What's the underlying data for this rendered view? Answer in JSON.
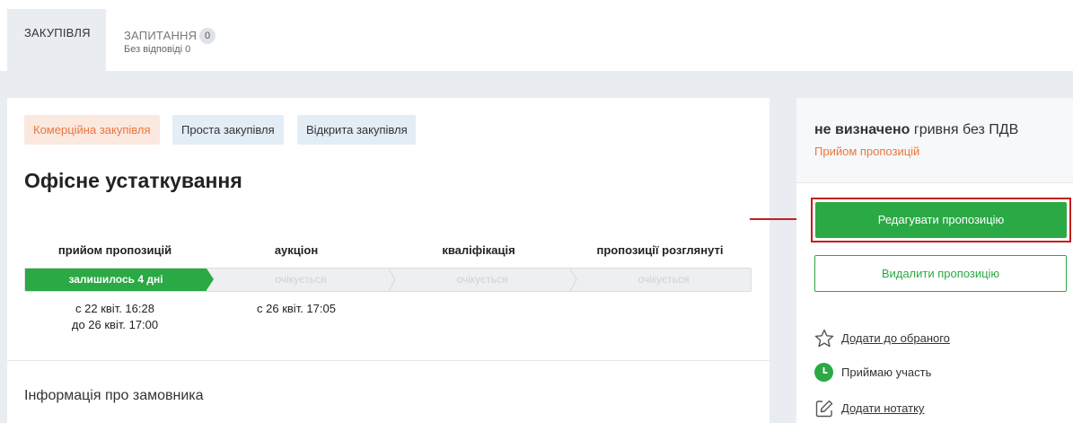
{
  "tabs": [
    {
      "label": "ЗАКУПІВЛЯ",
      "active": true
    },
    {
      "label": "ЗАПИТАННЯ",
      "count": "0",
      "sub": "Без відповіді 0"
    }
  ],
  "chips": [
    "Комерційна закупівля",
    "Проста закупівля",
    "Відкрита закупівля"
  ],
  "tender": {
    "title": "Офісне устаткування"
  },
  "stages": [
    {
      "title": "прийом пропозицій",
      "bar": "залишилось 4 дні",
      "dates": [
        "с 22 квіт. 16:28",
        "до 26 квіт. 17:00"
      ]
    },
    {
      "title": "аукціон",
      "bar": "очікується",
      "dates": [
        "с 26 квіт. 17:05"
      ]
    },
    {
      "title": "кваліфікація",
      "bar": "очікується",
      "dates": []
    },
    {
      "title": "пропозиції розглянуті",
      "bar": "очікується",
      "dates": []
    }
  ],
  "progress_value": 0.25,
  "customer_section": "Інформація про замовника",
  "price": {
    "amount": "не визначено",
    "suffix": "гривня без ПДВ",
    "status": "Прийом пропозицій"
  },
  "buttons": {
    "edit": "Редагувати пропозицію",
    "delete": "Видалити пропозицію"
  },
  "actions": [
    {
      "label": "Додати до обраного",
      "icon": "star-icon"
    },
    {
      "label": "Приймаю участь",
      "icon": "clock-icon"
    },
    {
      "label": "Додати нотатку",
      "icon": "edit-note-icon"
    }
  ],
  "colors": {
    "green": "#2aa944",
    "orange": "#e8773f",
    "highlight": "#c41e1e"
  }
}
